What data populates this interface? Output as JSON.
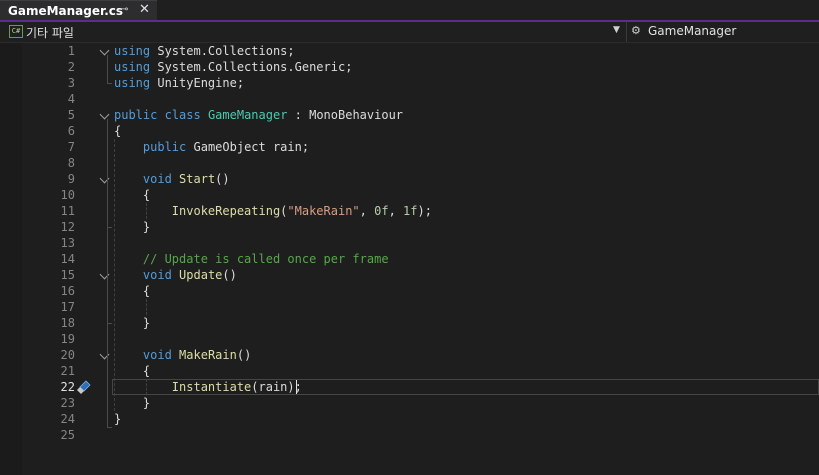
{
  "tab": {
    "title": "GameManager.cs",
    "pin_glyph": "⊸",
    "close_glyph": "✕"
  },
  "nav": {
    "project_label": "기타 파일",
    "project_icon": "C#",
    "class_label": "GameManager"
  },
  "editor": {
    "active_line": "22",
    "lines": [
      {
        "n": "1",
        "tokens": [
          {
            "t": "using",
            "c": "kw"
          },
          {
            "t": " System.Collections;",
            "c": "tx"
          }
        ]
      },
      {
        "n": "2",
        "tokens": [
          {
            "t": "using",
            "c": "kw"
          },
          {
            "t": " System.Collections.Generic;",
            "c": "tx"
          }
        ]
      },
      {
        "n": "3",
        "tokens": [
          {
            "t": "using",
            "c": "kw"
          },
          {
            "t": " UnityEngine;",
            "c": "tx"
          }
        ]
      },
      {
        "n": "4",
        "tokens": []
      },
      {
        "n": "5",
        "tokens": [
          {
            "t": "public",
            "c": "kw"
          },
          {
            "t": " ",
            "c": "tx"
          },
          {
            "t": "class",
            "c": "kw"
          },
          {
            "t": " ",
            "c": "tx"
          },
          {
            "t": "GameManager",
            "c": "ty"
          },
          {
            "t": " : MonoBehaviour",
            "c": "tx"
          }
        ]
      },
      {
        "n": "6",
        "tokens": [
          {
            "t": "{",
            "c": "tx"
          }
        ]
      },
      {
        "n": "7",
        "tokens": [
          {
            "t": "    ",
            "c": "tx"
          },
          {
            "t": "public",
            "c": "kw"
          },
          {
            "t": " GameObject rain;",
            "c": "tx"
          }
        ]
      },
      {
        "n": "8",
        "tokens": []
      },
      {
        "n": "9",
        "tokens": [
          {
            "t": "    ",
            "c": "tx"
          },
          {
            "t": "void",
            "c": "kw"
          },
          {
            "t": " ",
            "c": "tx"
          },
          {
            "t": "Start",
            "c": "fn"
          },
          {
            "t": "()",
            "c": "tx"
          }
        ]
      },
      {
        "n": "10",
        "tokens": [
          {
            "t": "    {",
            "c": "tx"
          }
        ]
      },
      {
        "n": "11",
        "tokens": [
          {
            "t": "        ",
            "c": "tx"
          },
          {
            "t": "InvokeRepeating",
            "c": "fn"
          },
          {
            "t": "(",
            "c": "tx"
          },
          {
            "t": "\"MakeRain\"",
            "c": "st"
          },
          {
            "t": ", ",
            "c": "tx"
          },
          {
            "t": "0f",
            "c": "nu"
          },
          {
            "t": ", ",
            "c": "tx"
          },
          {
            "t": "1f",
            "c": "nu"
          },
          {
            "t": ");",
            "c": "tx"
          }
        ]
      },
      {
        "n": "12",
        "tokens": [
          {
            "t": "    }",
            "c": "tx"
          }
        ]
      },
      {
        "n": "13",
        "tokens": []
      },
      {
        "n": "14",
        "tokens": [
          {
            "t": "    ",
            "c": "tx"
          },
          {
            "t": "// Update is called once per frame",
            "c": "cm"
          }
        ]
      },
      {
        "n": "15",
        "tokens": [
          {
            "t": "    ",
            "c": "tx"
          },
          {
            "t": "void",
            "c": "kw"
          },
          {
            "t": " ",
            "c": "tx"
          },
          {
            "t": "Update",
            "c": "fn"
          },
          {
            "t": "()",
            "c": "tx"
          }
        ]
      },
      {
        "n": "16",
        "tokens": [
          {
            "t": "    {",
            "c": "tx"
          }
        ]
      },
      {
        "n": "17",
        "tokens": []
      },
      {
        "n": "18",
        "tokens": [
          {
            "t": "    }",
            "c": "tx"
          }
        ]
      },
      {
        "n": "19",
        "tokens": []
      },
      {
        "n": "20",
        "tokens": [
          {
            "t": "    ",
            "c": "tx"
          },
          {
            "t": "void",
            "c": "kw"
          },
          {
            "t": " ",
            "c": "tx"
          },
          {
            "t": "MakeRain",
            "c": "fn"
          },
          {
            "t": "()",
            "c": "tx"
          }
        ]
      },
      {
        "n": "21",
        "tokens": [
          {
            "t": "    {",
            "c": "tx"
          }
        ]
      },
      {
        "n": "22",
        "tokens": [
          {
            "t": "        ",
            "c": "tx"
          },
          {
            "t": "Instantiate",
            "c": "fn"
          },
          {
            "t": "(rain);",
            "c": "tx"
          }
        ]
      },
      {
        "n": "23",
        "tokens": [
          {
            "t": "    }",
            "c": "tx"
          }
        ]
      },
      {
        "n": "24",
        "tokens": [
          {
            "t": "}",
            "c": "tx"
          }
        ]
      },
      {
        "n": "25",
        "tokens": []
      }
    ],
    "fold_lines": [
      "1",
      "5",
      "9",
      "15",
      "20"
    ]
  },
  "colors": {
    "keyword": "#569cd6",
    "type": "#4ec9b0",
    "function": "#dcdcaa",
    "string": "#d69d85",
    "number": "#b5cea8",
    "comment": "#57a64a",
    "text": "#dcdcdc",
    "accent": "#5c2d91"
  }
}
